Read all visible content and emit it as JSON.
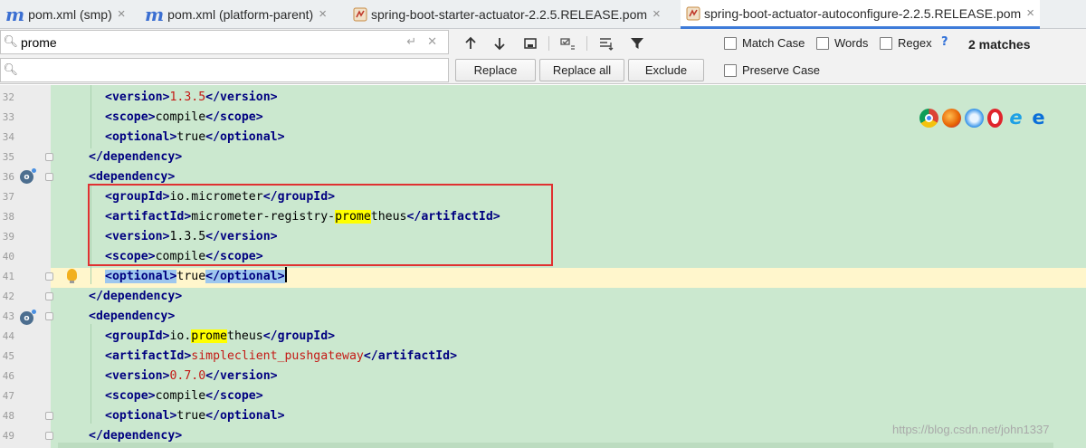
{
  "tabs": [
    {
      "icon": "m",
      "label": "pom.xml (smp)",
      "active": false
    },
    {
      "icon": "m",
      "label": "pom.xml (platform-parent)",
      "active": false
    },
    {
      "icon": "pom",
      "label": "spring-boot-starter-actuator-2.2.5.RELEASE.pom",
      "active": false
    },
    {
      "icon": "pom",
      "label": "spring-boot-actuator-autoconfigure-2.2.5.RELEASE.pom",
      "active": true
    }
  ],
  "tab_close_glyph": "×",
  "find": {
    "search_value": "prome",
    "replace_value": "",
    "toolbar_icons": [
      "arrow-up-icon",
      "arrow-down-icon",
      "select-all-occurrences-icon",
      "filter-options-icon",
      "match-settings-icon",
      "funnel-icon"
    ],
    "options": {
      "match_case": "Match Case",
      "words": "Words",
      "regex": "Regex",
      "help": "?",
      "preserve_case": "Preserve Case"
    },
    "matches": "2 matches",
    "buttons": {
      "replace": "Replace",
      "replace_all": "Replace all",
      "exclude": "Exclude"
    }
  },
  "editor": {
    "lines": [
      {
        "no": "32",
        "indent": 2,
        "parts": [
          [
            "t",
            "<version>"
          ],
          [
            "v",
            "1.3.5"
          ],
          [
            "t",
            "</version>"
          ]
        ]
      },
      {
        "no": "33",
        "indent": 2,
        "parts": [
          [
            "t",
            "<scope>"
          ],
          [
            "p",
            "compile"
          ],
          [
            "t",
            "</scope>"
          ]
        ]
      },
      {
        "no": "34",
        "indent": 2,
        "parts": [
          [
            "t",
            "<optional>"
          ],
          [
            "p",
            "true"
          ],
          [
            "t",
            "</optional>"
          ]
        ]
      },
      {
        "no": "35",
        "indent": 1,
        "parts": [
          [
            "t",
            "</dependency>"
          ]
        ]
      },
      {
        "no": "36",
        "indent": 1,
        "parts": [
          [
            "t",
            "<dependency>"
          ]
        ]
      },
      {
        "no": "37",
        "indent": 2,
        "parts": [
          [
            "t",
            "<groupId>"
          ],
          [
            "p",
            "io.micrometer"
          ],
          [
            "t",
            "</groupId>"
          ]
        ]
      },
      {
        "no": "38",
        "indent": 2,
        "parts": [
          [
            "t",
            "<artifactId>"
          ],
          [
            "p",
            "micrometer-registry-"
          ],
          [
            "h",
            "prome"
          ],
          [
            "p",
            "theus"
          ],
          [
            "t",
            "</artifactId>"
          ]
        ]
      },
      {
        "no": "39",
        "indent": 2,
        "parts": [
          [
            "t",
            "<version>"
          ],
          [
            "p",
            "1.3.5"
          ],
          [
            "t",
            "</version>"
          ]
        ]
      },
      {
        "no": "40",
        "indent": 2,
        "parts": [
          [
            "t",
            "<scope>"
          ],
          [
            "p",
            "compile"
          ],
          [
            "t",
            "</scope>"
          ]
        ]
      },
      {
        "no": "41",
        "indent": 2,
        "parts": [
          [
            "st",
            "<optional>"
          ],
          [
            "p",
            "true"
          ],
          [
            "st",
            "</optional>"
          ],
          [
            "c",
            ""
          ]
        ]
      },
      {
        "no": "42",
        "indent": 1,
        "parts": [
          [
            "t",
            "</dependency>"
          ]
        ]
      },
      {
        "no": "43",
        "indent": 1,
        "parts": [
          [
            "t",
            "<dependency>"
          ]
        ]
      },
      {
        "no": "44",
        "indent": 2,
        "parts": [
          [
            "t",
            "<groupId>"
          ],
          [
            "p",
            "io."
          ],
          [
            "h",
            "prome"
          ],
          [
            "p",
            "theus"
          ],
          [
            "t",
            "</groupId>"
          ]
        ]
      },
      {
        "no": "45",
        "indent": 2,
        "parts": [
          [
            "t",
            "<artifactId>"
          ],
          [
            "v",
            "simpleclient_pushgateway"
          ],
          [
            "t",
            "</artifactId>"
          ]
        ]
      },
      {
        "no": "46",
        "indent": 2,
        "parts": [
          [
            "t",
            "<version>"
          ],
          [
            "v",
            "0.7.0"
          ],
          [
            "t",
            "</version>"
          ]
        ]
      },
      {
        "no": "47",
        "indent": 2,
        "parts": [
          [
            "t",
            "<scope>"
          ],
          [
            "p",
            "compile"
          ],
          [
            "t",
            "</scope>"
          ]
        ]
      },
      {
        "no": "48",
        "indent": 2,
        "parts": [
          [
            "t",
            "<optional>"
          ],
          [
            "p",
            "true"
          ],
          [
            "t",
            "</optional>"
          ]
        ]
      },
      {
        "no": "49",
        "indent": 1,
        "parts": [
          [
            "t",
            "</dependency>"
          ]
        ]
      }
    ]
  },
  "browser_icons": [
    "chrome-icon",
    "firefox-icon",
    "safari-icon",
    "opera-icon",
    "internet-explorer-icon",
    "edge-icon"
  ],
  "watermark": "https://blog.csdn.net/john1337",
  "colors": {
    "editor_bg": "#cbe8cf",
    "tag": "#000080",
    "value": "#c41a16",
    "match_highlight": "#ffff00",
    "annotation_box": "#e03131",
    "accent": "#3d7bd9"
  }
}
